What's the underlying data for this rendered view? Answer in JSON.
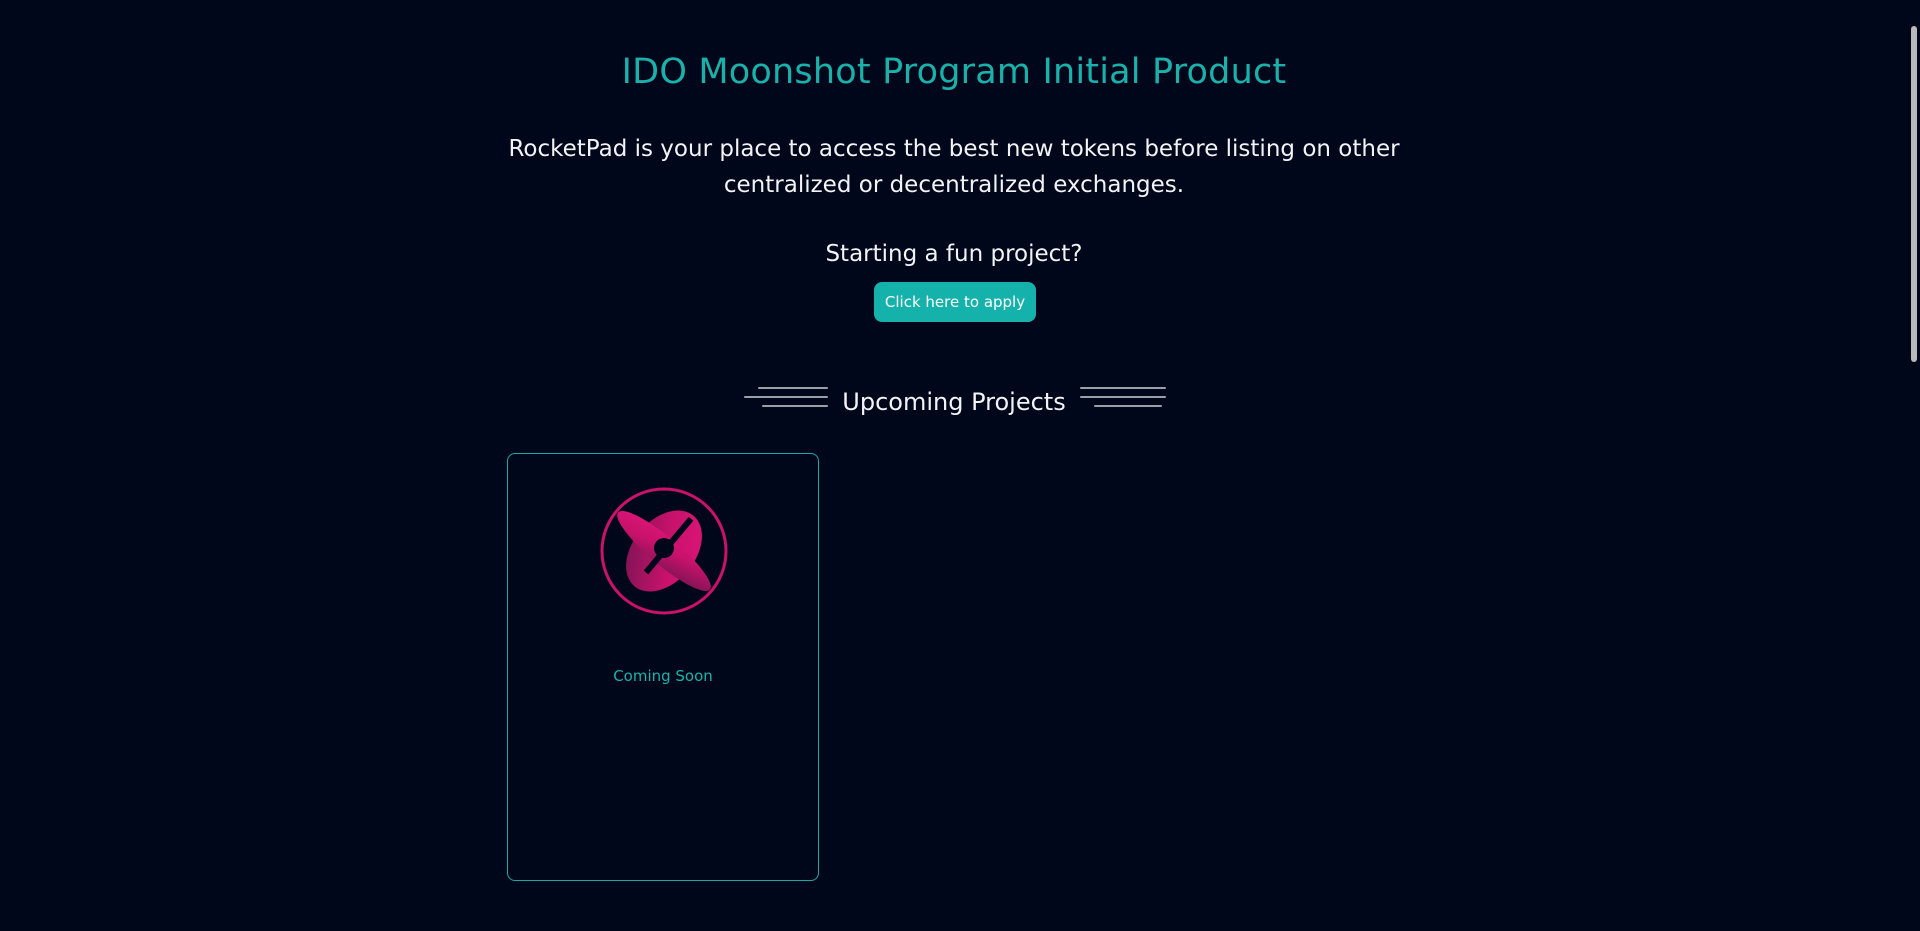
{
  "header": {
    "title": "IDO Moonshot Program Initial Product",
    "intro": "RocketPad is your place to access the best new tokens before listing on other centralized or decentralized exchanges."
  },
  "apply": {
    "prompt": "Starting a fun project?",
    "button_label": "Click here to apply"
  },
  "upcoming": {
    "heading": "Upcoming Projects",
    "projects": [
      {
        "status": "Coming Soon",
        "logo_icon": "rocketpad-planet-icon"
      }
    ]
  },
  "colors": {
    "background": "#01071a",
    "accent": "#15b2ac",
    "text": "#f2f3f5",
    "logo": "#c8126b"
  }
}
